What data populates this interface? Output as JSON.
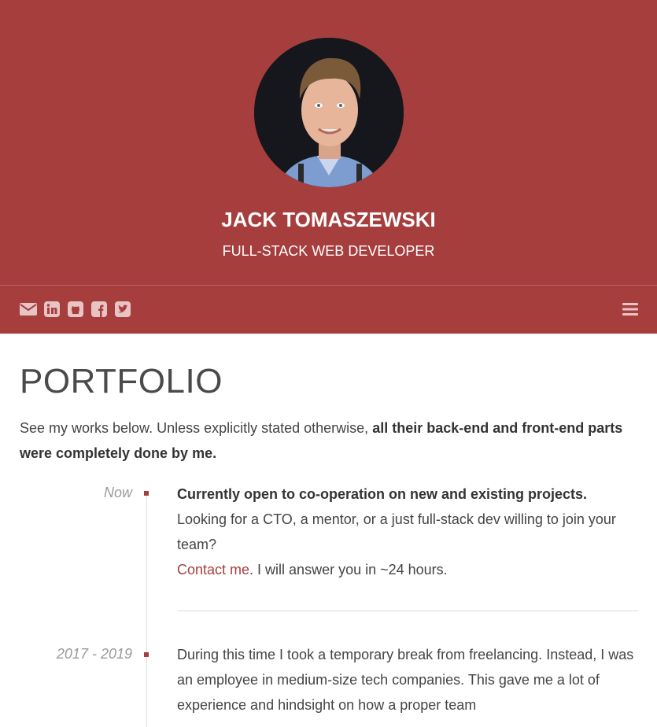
{
  "profile": {
    "name": "JACK TOMASZEWSKI",
    "title": "FULL-STACK WEB DEVELOPER"
  },
  "social": [
    "envelope-icon",
    "linkedin-icon",
    "github-icon",
    "facebook-icon",
    "twitter-icon"
  ],
  "menu_icon": "hamburger-menu-icon",
  "colors": {
    "accent": "#a63e3e",
    "text": "#444444",
    "muted": "#9a9a9a"
  },
  "page": {
    "heading": "PORTFOLIO",
    "intro_text": "See my works below. Unless explicitly stated otherwise, ",
    "intro_bold": "all their back-end and front-end parts were completely done by me."
  },
  "timeline": [
    {
      "date": "Now",
      "bold": "Currently open to co-operation on new and existing projects.",
      "text": "Looking for a CTO, a mentor, or a just full-stack dev willing to join your team?",
      "link": "Contact me",
      "after_link": ". I will answer you in ~24 hours."
    },
    {
      "date": "2017 - 2019",
      "text": "During this time I took a temporary break from freelancing. Instead, I was an employee in medium-size tech companies. This gave me a lot of experience and hindsight on how a proper team"
    }
  ]
}
